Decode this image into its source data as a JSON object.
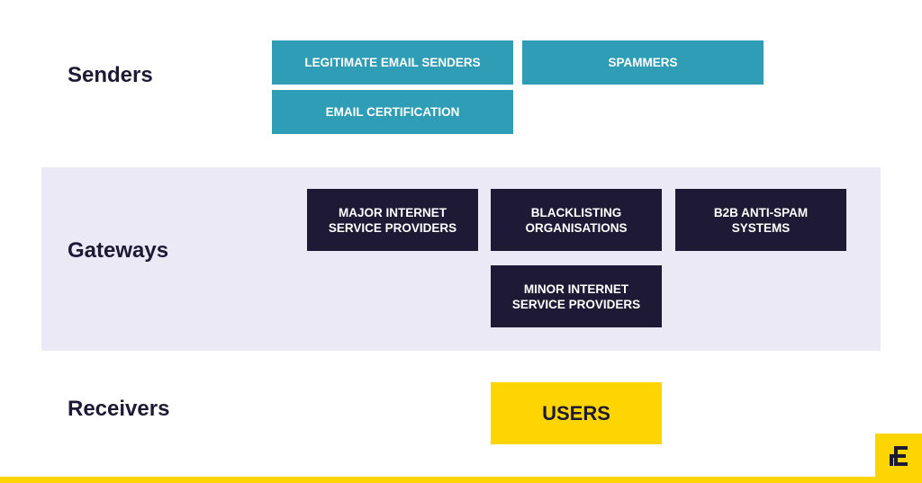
{
  "rows": {
    "senders": {
      "label": "Senders",
      "boxes": [
        "LEGITIMATE EMAIL SENDERS",
        "SPAMMERS",
        "EMAIL CERTIFICATION"
      ]
    },
    "gateways": {
      "label": "Gateways",
      "boxes": [
        "MAJOR INTERNET\nSERVICE PROVIDERS",
        "BLACKLISTING\nORGANISATIONS",
        "B2B ANTI-SPAM\nSYSTEMS",
        "MINOR INTERNET\nSERVICE PROVIDERS"
      ]
    },
    "receivers": {
      "label": "Receivers",
      "boxes": [
        "USERS"
      ]
    }
  },
  "colors": {
    "senders_box": "#2e9db5",
    "gateways_box": "#1e1a35",
    "receivers_box": "#ffd500",
    "gateways_band": "#ebe9f5",
    "text_dark": "#1e1a35"
  },
  "logo": {
    "icon": "brand-e-logo-icon"
  }
}
